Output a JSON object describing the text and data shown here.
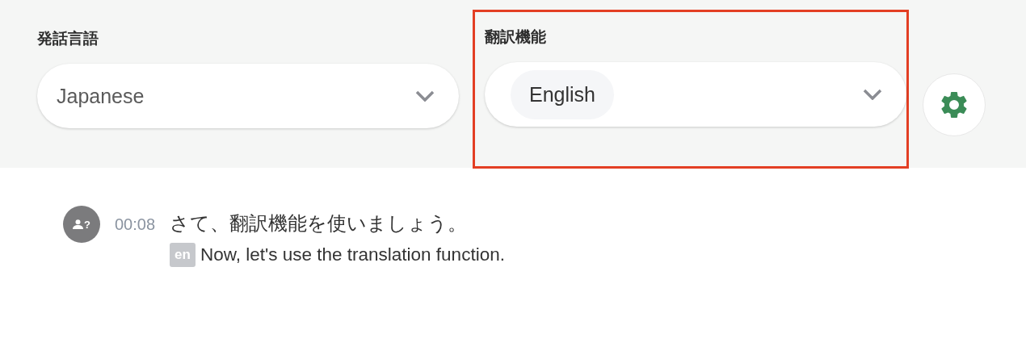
{
  "controls": {
    "spoken_language": {
      "label": "発話言語",
      "value": "Japanese"
    },
    "translation": {
      "label": "翻訳機能",
      "highlighted": true,
      "chips": [
        "English"
      ]
    }
  },
  "transcript": [
    {
      "speaker_badge": "?",
      "time": "00:08",
      "text": "さて、翻訳機能を使いましょう。",
      "translations": [
        {
          "lang": "en",
          "text": "Now, let's use the translation function."
        }
      ]
    }
  ]
}
